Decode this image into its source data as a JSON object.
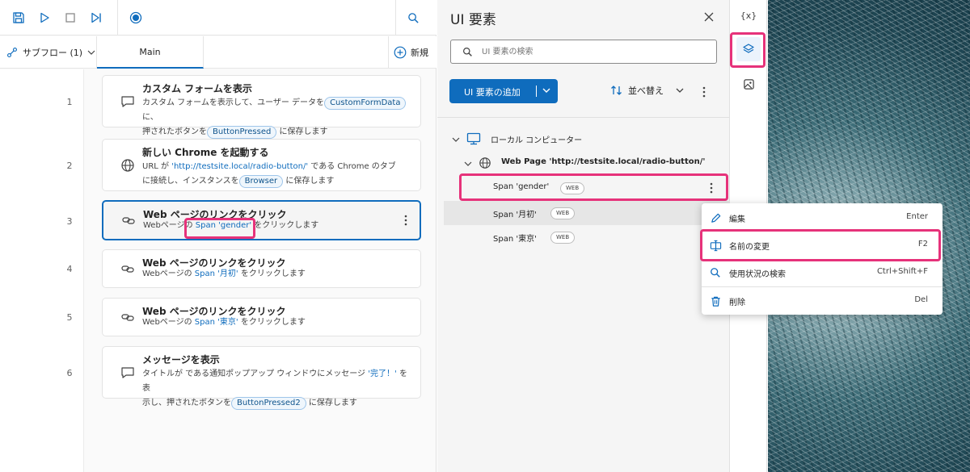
{
  "toolbar": {
    "save_icon": "save-icon",
    "run_icon": "play-icon",
    "stop_icon": "stop-icon",
    "step_icon": "step-icon",
    "record_icon": "record-icon",
    "search_icon": "search-icon"
  },
  "tabs": {
    "subflow_label": "サブフロー (1)",
    "main_label": "Main",
    "new_label": "新規"
  },
  "steps": [
    {
      "num": "1",
      "icon": "message-icon",
      "title": "カスタム フォームを表示",
      "d1": "カスタム フォームを表示して、ユーザー データを",
      "d1_pill": "CustomFormData",
      "d1_end": "に、",
      "d2": "押されたボタンを",
      "d2_pill": "ButtonPressed",
      "d2_end": "に保存します"
    },
    {
      "num": "2",
      "icon": "globe-icon",
      "title": "新しい Chrome を起動する",
      "d1": "URL が",
      "d1_link": "'http://testsite.local/radio-button/'",
      "d1_end": "である Chrome のタブ",
      "d2": "に接続し、インスタンスを",
      "d2_pill": "Browser",
      "d2_end": "に保存します"
    },
    {
      "num": "3",
      "icon": "link-icon",
      "title": "Web ページのリンクをクリック",
      "d1": "Webページの",
      "d1_link": "Span 'gender'",
      "d1_end": "をクリックします"
    },
    {
      "num": "4",
      "icon": "link-icon",
      "title": "Web ページのリンクをクリック",
      "d1": "Webページの",
      "d1_link": "Span '月初'",
      "d1_end": "をクリックします"
    },
    {
      "num": "5",
      "icon": "link-icon",
      "title": "Web ページのリンクをクリック",
      "d1": "Webページの",
      "d1_link": "Span '東京'",
      "d1_end": "をクリックします"
    },
    {
      "num": "6",
      "icon": "message-icon",
      "title": "メッセージを表示",
      "d1": "タイトルが  である通知ポップアップ ウィンドウにメッセージ",
      "d1_link": "'完了！'",
      "d1_end": "を表",
      "d2": "示し、押されたボタンを",
      "d2_pill": "ButtonPressed2",
      "d2_end": "に保存します"
    }
  ],
  "ui_panel": {
    "title": "UI 要素",
    "search_placeholder": "UI 要素の検索",
    "add_label": "UI 要素の追加",
    "sort_label": "並べ替え",
    "tree": {
      "computer": "ローカル コンピューター",
      "page": "Web Page 'http://testsite.local/radio-button/'",
      "items": [
        {
          "label": "Span 'gender'",
          "tag": "WEB"
        },
        {
          "label": "Span '月初'",
          "tag": "WEB"
        },
        {
          "label": "Span '東京'",
          "tag": "WEB"
        }
      ]
    }
  },
  "strip": {
    "variables_label": "{x}",
    "ui_elements_icon": "layers-icon",
    "images_icon": "image-icon"
  },
  "context_menu": [
    {
      "icon": "pencil-icon",
      "label": "編集",
      "shortcut": "Enter"
    },
    {
      "icon": "rename-icon",
      "label": "名前の変更",
      "shortcut": "F2"
    },
    {
      "icon": "search-icon",
      "label": "使用状況の検索",
      "shortcut": "Ctrl+Shift+F"
    },
    {
      "icon": "trash-icon",
      "label": "削除",
      "shortcut": "Del"
    }
  ],
  "colors": {
    "accent": "#0f6cbd",
    "highlight": "#e6327a"
  }
}
